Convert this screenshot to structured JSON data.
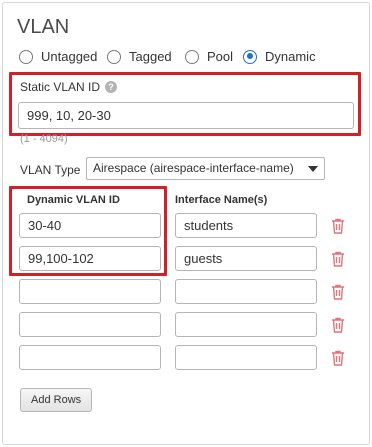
{
  "section": {
    "title": "VLAN"
  },
  "vlan_mode": {
    "options": [
      {
        "label": "Untagged",
        "checked": false
      },
      {
        "label": "Tagged",
        "checked": false
      },
      {
        "label": "Pool",
        "checked": false
      },
      {
        "label": "Dynamic",
        "checked": true
      }
    ]
  },
  "static_vlan": {
    "label": "Static VLAN ID",
    "help_icon": "question-icon",
    "value": "999, 10, 20-30",
    "range_hint": "(1 - 4094)"
  },
  "vlan_type": {
    "label": "VLAN Type",
    "selected": "Airespace (airespace-interface-name)"
  },
  "table": {
    "columns": [
      "Dynamic VLAN ID",
      "Interface Name(s)"
    ],
    "rows": [
      {
        "vlan_id": "30-40",
        "interface": "students"
      },
      {
        "vlan_id": "99,100-102",
        "interface": "guests"
      },
      {
        "vlan_id": "",
        "interface": ""
      },
      {
        "vlan_id": "",
        "interface": ""
      },
      {
        "vlan_id": "",
        "interface": ""
      }
    ]
  },
  "actions": {
    "add_rows": "Add Rows"
  },
  "colors": {
    "accent": "#1d6fd1",
    "highlight": "#d41f2a",
    "trash": "#e2747a"
  }
}
